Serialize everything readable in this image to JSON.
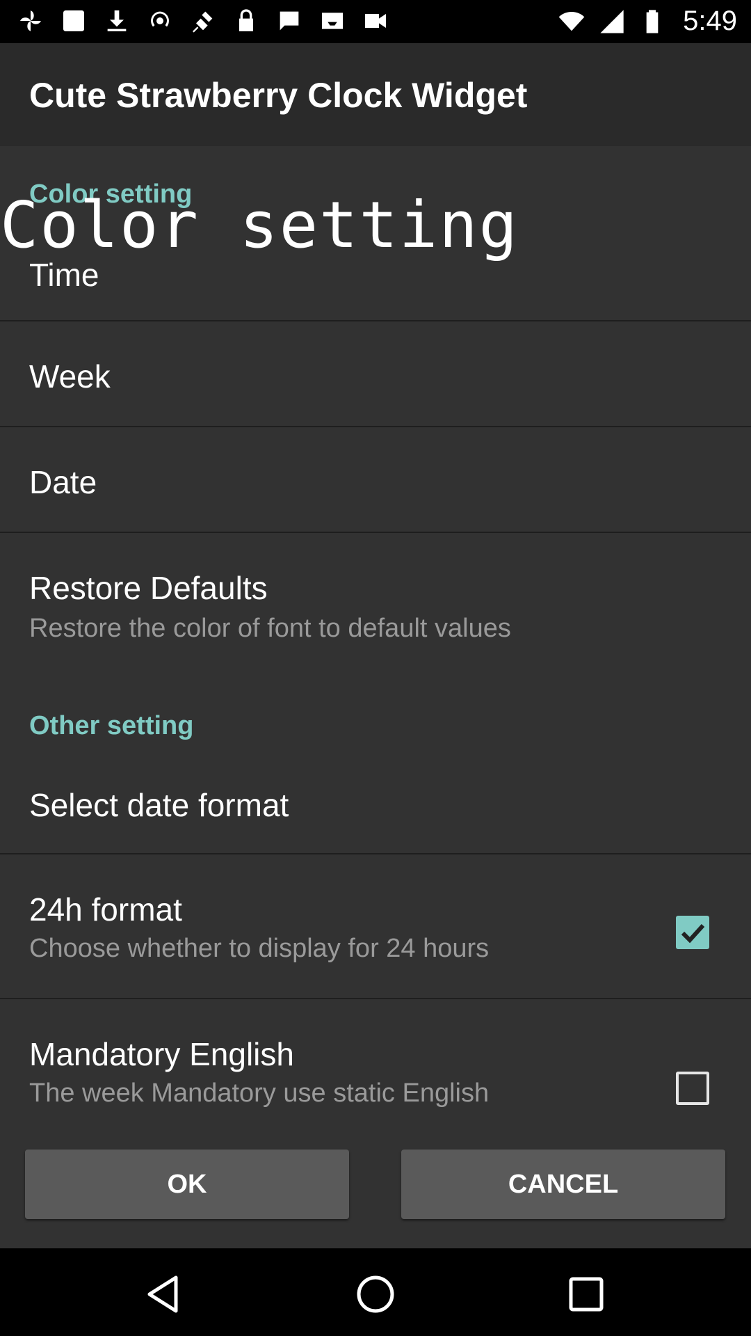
{
  "status_bar": {
    "time": "5:49",
    "left_icons": [
      "pinwheel-icon",
      "image-icon",
      "download-icon",
      "hotspot-icon",
      "satellite-icon",
      "lock-icon",
      "chat-bubble-icon",
      "inbox-icon",
      "video-icon"
    ]
  },
  "app": {
    "title": "Cute Strawberry Clock Widget"
  },
  "sections": {
    "color": {
      "header": "Color setting",
      "overlay": "Color setting",
      "time_label": "Time",
      "week_label": "Week",
      "date_label": "Date",
      "restore_title": "Restore Defaults",
      "restore_summary": "Restore the color of font to default values"
    },
    "other": {
      "header": "Other setting",
      "date_format_label": "Select date format",
      "h24_title": "24h format",
      "h24_summary": "Choose whether to display for 24 hours",
      "h24_checked": true,
      "mandatory_title": "Mandatory English",
      "mandatory_summary": "The week Mandatory use static English",
      "mandatory_checked": false
    }
  },
  "buttons": {
    "ok": "OK",
    "cancel": "CANCEL"
  },
  "colors": {
    "accent": "#80cbc4",
    "background": "#323232",
    "header_bg": "#2a2a2a"
  }
}
